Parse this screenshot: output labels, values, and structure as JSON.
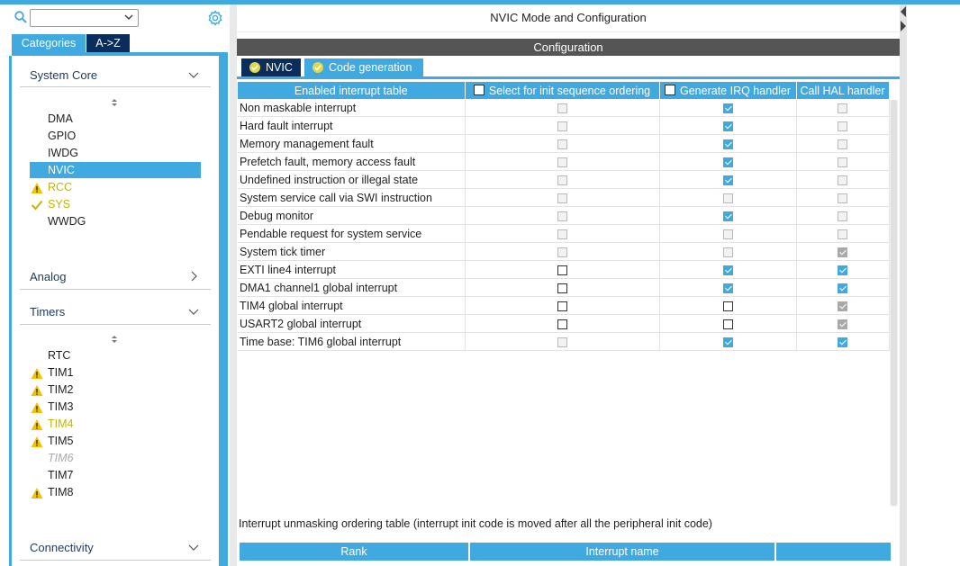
{
  "window": {
    "title": "NVIC Mode and Configuration"
  },
  "left": {
    "search": {
      "value": ""
    },
    "tabs": {
      "categories": "Categories",
      "az": "A->Z"
    },
    "sections": {
      "system_core": "System Core",
      "analog": "Analog",
      "timers": "Timers",
      "connectivity": "Connectivity"
    },
    "system_core_items": [
      "DMA",
      "GPIO",
      "IWDG",
      "NVIC",
      "RCC",
      "SYS",
      "WWDG"
    ],
    "timer_items": [
      "RTC",
      "TIM1",
      "TIM2",
      "TIM3",
      "TIM4",
      "TIM5",
      "TIM6",
      "TIM7",
      "TIM8"
    ]
  },
  "config": {
    "header": "Configuration",
    "tabs": {
      "nvic": "NVIC",
      "code_generation": "Code generation"
    },
    "table": {
      "headers": {
        "name": "Enabled interrupt table",
        "init_seq": "Select for init sequence ordering",
        "gen_irq": "Generate IRQ handler",
        "call_hal": "Call HAL handler"
      },
      "rows": [
        {
          "name": "Non maskable interrupt",
          "init": "dis-empty",
          "irq": "checked",
          "hal": "dis-empty"
        },
        {
          "name": "Hard fault interrupt",
          "init": "dis-empty",
          "irq": "checked",
          "hal": "dis-empty"
        },
        {
          "name": "Memory management fault",
          "init": "dis-empty",
          "irq": "checked",
          "hal": "dis-empty"
        },
        {
          "name": "Prefetch fault, memory access fault",
          "init": "dis-empty",
          "irq": "checked",
          "hal": "dis-empty"
        },
        {
          "name": "Undefined instruction or illegal state",
          "init": "dis-empty",
          "irq": "checked",
          "hal": "dis-empty"
        },
        {
          "name": "System service call via SWI instruction",
          "init": "dis-empty",
          "irq": "dis-empty",
          "hal": "dis-empty"
        },
        {
          "name": "Debug monitor",
          "init": "dis-empty",
          "irq": "checked",
          "hal": "dis-empty"
        },
        {
          "name": "Pendable request for system service",
          "init": "dis-empty",
          "irq": "dis-empty",
          "hal": "dis-empty"
        },
        {
          "name": "System tick timer",
          "init": "dis-empty",
          "irq": "dis-empty",
          "hal": "dis-checked"
        },
        {
          "name": "EXTI line4 interrupt",
          "init": "empty",
          "irq": "checked",
          "hal": "checked"
        },
        {
          "name": "DMA1 channel1 global interrupt",
          "init": "empty",
          "irq": "checked",
          "hal": "checked"
        },
        {
          "name": "TIM4 global interrupt",
          "init": "empty",
          "irq": "empty",
          "hal": "dis-checked"
        },
        {
          "name": "USART2 global interrupt",
          "init": "empty",
          "irq": "empty",
          "hal": "dis-checked"
        },
        {
          "name": "Time base: TIM6 global interrupt",
          "init": "dis-empty",
          "irq": "checked",
          "hal": "checked"
        }
      ]
    },
    "unmask_label": "Interrupt unmasking ordering table (interrupt init code is moved after all the peripheral init code)",
    "rank_table": {
      "rank": "Rank",
      "interrupt_name": "Interrupt name"
    }
  }
}
